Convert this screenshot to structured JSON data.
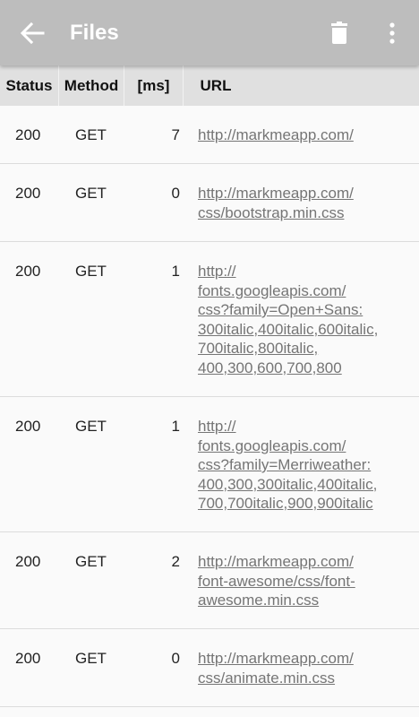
{
  "app_bar": {
    "title": "Files",
    "back_icon": "arrow-back-icon",
    "delete_icon": "trash-icon",
    "menu_icon": "more-vert-icon",
    "background": "#bdbdbd"
  },
  "table": {
    "columns": [
      "Status",
      "Method",
      "[ms]",
      "URL"
    ],
    "rows": [
      {
        "status": "200",
        "method": "GET",
        "ms": "7",
        "url": "http://markmeapp.com/"
      },
      {
        "status": "200",
        "method": "GET",
        "ms": "0",
        "url": "http://markmeapp.com/\ncss/bootstrap.min.css"
      },
      {
        "status": "200",
        "method": "GET",
        "ms": "1",
        "url": "http://\nfonts.googleapis.com/\ncss?family=Open+Sans:\n300italic,400italic,600italic,\n700italic,800italic,\n400,300,600,700,800"
      },
      {
        "status": "200",
        "method": "GET",
        "ms": "1",
        "url": "http://\nfonts.googleapis.com/\ncss?family=Merriweather:\n400,300,300italic,400italic,\n700,700italic,900,900italic"
      },
      {
        "status": "200",
        "method": "GET",
        "ms": "2",
        "url": "http://markmeapp.com/\nfont-awesome/css/font-\nawesome.min.css"
      },
      {
        "status": "200",
        "method": "GET",
        "ms": "0",
        "url": "http://markmeapp.com/\ncss/animate.min.css"
      }
    ]
  }
}
